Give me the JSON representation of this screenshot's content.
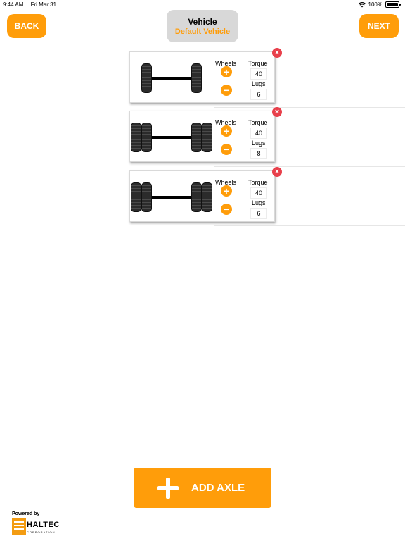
{
  "status_bar": {
    "time": "9:44 AM",
    "date": "Fri Mar 31",
    "battery": "100%"
  },
  "header": {
    "back_label": "BACK",
    "next_label": "NEXT",
    "vehicle_title": "Vehicle",
    "vehicle_name": "Default Vehicle"
  },
  "axles": [
    {
      "wheels_label": "Wheels",
      "torque_label": "Torque",
      "torque": "40",
      "lugs_label": "Lugs",
      "lugs": "6"
    },
    {
      "wheels_label": "Wheels",
      "torque_label": "Torque",
      "torque": "40",
      "lugs_label": "Lugs",
      "lugs": "8"
    },
    {
      "wheels_label": "Wheels",
      "torque_label": "Torque",
      "torque": "40",
      "lugs_label": "Lugs",
      "lugs": "6"
    }
  ],
  "add_axle_label": "ADD AXLE",
  "footer": {
    "powered_by": "Powered by",
    "logo_text": "HALTEC",
    "logo_sub": "CORPORATION"
  },
  "colors": {
    "accent": "#ff9d0a",
    "remove": "#e8404b",
    "vehicle_box": "#d8d8d8"
  },
  "icons": {
    "remove": "close-icon",
    "increase": "plus-icon",
    "decrease": "minus-icon",
    "wifi": "wifi-icon",
    "battery": "battery-icon"
  }
}
